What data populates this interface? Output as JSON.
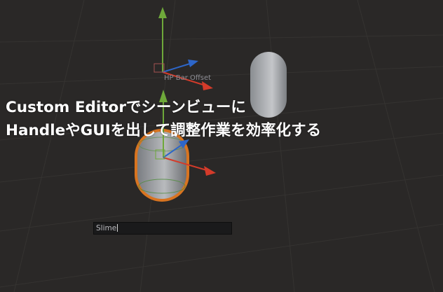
{
  "scene": {
    "gizmo_label": "HP Bar Offset",
    "name_field": {
      "value": "Slime"
    }
  },
  "overlay": {
    "title_line1": "Custom Editorでシーンビューに",
    "title_line2": "HandleやGUIを出して調整作業を効率化する"
  },
  "colors": {
    "background": "#2a2827",
    "axis_x": "#d43b2a",
    "axis_y": "#6ea83a",
    "axis_z": "#2d66c9",
    "selection_outline": "#e07a1f"
  },
  "icons": [
    "move-gizmo-icon",
    "move-gizmo-small-icon"
  ]
}
